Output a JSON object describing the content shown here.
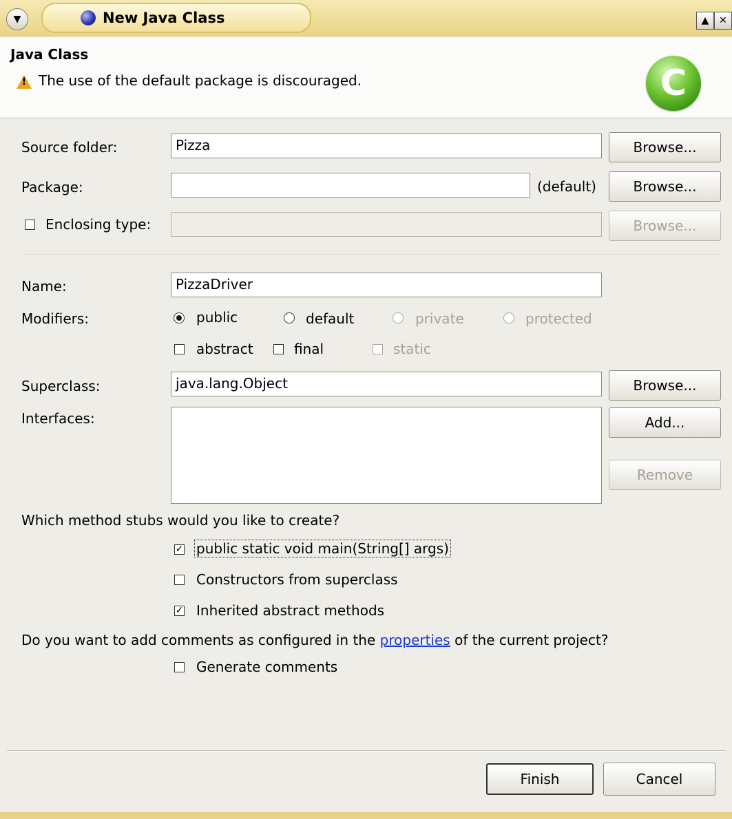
{
  "window": {
    "title": "New Java Class"
  },
  "header": {
    "title": "Java Class",
    "message": "The use of the default package is discouraged.",
    "class_icon_letter": "C"
  },
  "source_folder": {
    "label": "Source folder:",
    "value": "Pizza",
    "browse_label": "Browse..."
  },
  "package": {
    "label": "Package:",
    "value": "",
    "hint": "(default)",
    "browse_label": "Browse..."
  },
  "enclosing_type": {
    "label": "Enclosing type:",
    "checked": false,
    "value": "",
    "browse_label": "Browse..."
  },
  "name": {
    "label": "Name:",
    "value": "PizzaDriver"
  },
  "modifiers": {
    "label": "Modifiers:",
    "options": [
      {
        "label": "public",
        "selected": true,
        "enabled": true
      },
      {
        "label": "default",
        "selected": false,
        "enabled": true
      },
      {
        "label": "private",
        "selected": false,
        "enabled": false
      },
      {
        "label": "protected",
        "selected": false,
        "enabled": false
      }
    ],
    "checks": [
      {
        "label": "abstract",
        "checked": false,
        "enabled": true
      },
      {
        "label": "final",
        "checked": false,
        "enabled": true
      },
      {
        "label": "static",
        "checked": false,
        "enabled": false
      }
    ]
  },
  "superclass": {
    "label": "Superclass:",
    "value": "java.lang.Object",
    "browse_label": "Browse..."
  },
  "interfaces": {
    "label": "Interfaces:",
    "add_label": "Add...",
    "remove_label": "Remove"
  },
  "stubs": {
    "question": "Which method stubs would you like to create?",
    "options": [
      {
        "label": "public static void main(String[] args)",
        "checked": true
      },
      {
        "label": "Constructors from superclass",
        "checked": false
      },
      {
        "label": "Inherited abstract methods",
        "checked": true
      }
    ]
  },
  "comments": {
    "question_prefix": "Do you want to add comments as configured in the",
    "link": "properties",
    "question_suffix": "of the current project?",
    "generate_label": "Generate comments",
    "generate_checked": false
  },
  "footer": {
    "finish_label": "Finish",
    "cancel_label": "Cancel"
  },
  "colors": {
    "link": "#1c3bd6",
    "titlebar": "#e9d486",
    "warning": "#e8a41e",
    "class_icon": "#6dc531"
  }
}
